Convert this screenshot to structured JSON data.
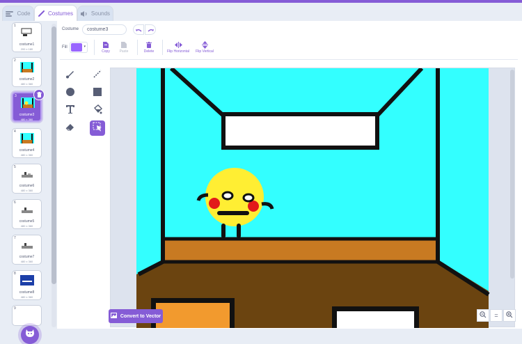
{
  "tabs": [
    {
      "label": "Code",
      "icon": "code-icon"
    },
    {
      "label": "Costumes",
      "icon": "brush-icon"
    },
    {
      "label": "Sounds",
      "icon": "speaker-icon"
    }
  ],
  "costumes": [
    {
      "number": "1",
      "name": "costume1",
      "size": "200 x 180"
    },
    {
      "number": "2",
      "name": "costume2",
      "size": "480 x 360"
    },
    {
      "number": "3",
      "name": "costume3",
      "size": "480 x 360"
    },
    {
      "number": "4",
      "name": "costume4",
      "size": "480 x 360"
    },
    {
      "number": "5",
      "name": "costume6",
      "size": "480 x 360"
    },
    {
      "number": "6",
      "name": "costume5",
      "size": "480 x 360"
    },
    {
      "number": "7",
      "name": "costume7",
      "size": "480 x 360"
    },
    {
      "number": "8",
      "name": "costume8",
      "size": "480 x 360"
    },
    {
      "number": "9",
      "name": "",
      "size": ""
    }
  ],
  "selected_costume_index": 2,
  "toolbar": {
    "costume_label": "Costume",
    "costume_name": "costume3",
    "fill_label": "Fill",
    "fill_color": "#9966ff",
    "copy_label": "Copy",
    "paste_label": "Paste",
    "delete_label": "Delete",
    "flip_horizontal_label": "Flip Horizontal",
    "flip_vertical_label": "Flip Vertical"
  },
  "tools": [
    "brush-icon",
    "line-icon",
    "circle-icon",
    "rectangle-icon",
    "text-icon",
    "fill-icon",
    "eraser-icon",
    "select-icon"
  ],
  "selected_tool": "select-icon",
  "convert_label": "Convert to Vector",
  "zoom": {
    "out": "−",
    "reset": "=",
    "in": "+"
  },
  "colors": {
    "accent": "#855cd6",
    "sky": "#33ffff",
    "floor": "#c87a22",
    "ground": "#6b4410",
    "face": "#ffee33"
  }
}
